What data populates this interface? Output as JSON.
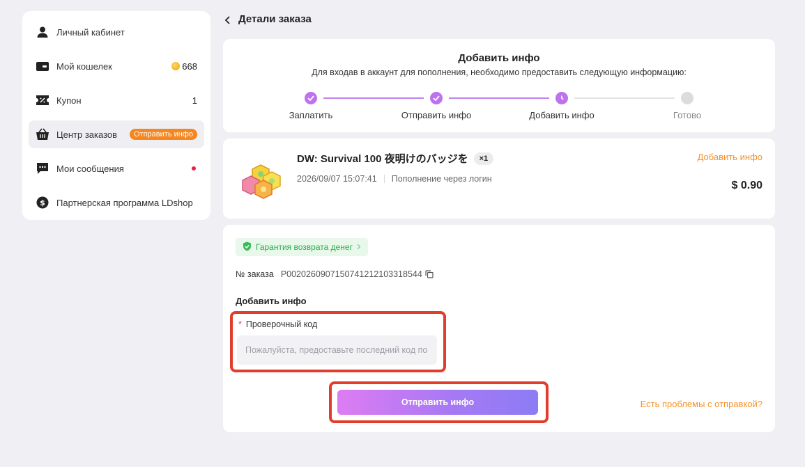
{
  "sidebar": {
    "items": [
      {
        "label": "Личный кабинет",
        "icon": "user-icon"
      },
      {
        "label": "Мой кошелек",
        "icon": "wallet-icon",
        "right": "668"
      },
      {
        "label": "Купон",
        "icon": "coupon-icon",
        "right": "1"
      },
      {
        "label": "Центр заказов",
        "icon": "basket-icon",
        "badge": "Отправить инфо",
        "active": true
      },
      {
        "label": "Мои сообщения",
        "icon": "message-icon",
        "dot": true
      },
      {
        "label": "Партнерская программа LDshop",
        "icon": "dollar-icon"
      }
    ]
  },
  "header": {
    "title": "Детали заказа"
  },
  "steps": {
    "title": "Добавить инфо",
    "subtitle": "Для входав в аккаунт для пополнения, необходимо предоставить следующую информацию:",
    "items": [
      {
        "label": "Заплатить",
        "state": "done"
      },
      {
        "label": "Отправить инфо",
        "state": "done"
      },
      {
        "label": "Добавить инфо",
        "state": "current"
      },
      {
        "label": "Готово",
        "state": "todo"
      }
    ]
  },
  "product": {
    "title": "DW: Survival 100 夜明けのバッジを",
    "qty": "×1",
    "date": "2026/09/07 15:07:41",
    "method": "Пополнение через логин",
    "status": "Добавить инфо",
    "price": "$ 0.90"
  },
  "form": {
    "guarantee": "Гарантия возврата денег",
    "order_label": "№ заказа",
    "order_number": "P0020260907150741212103318544",
    "section_title": "Добавить инфо",
    "field_label": "Проверочный код",
    "field_required": "*",
    "field_placeholder": "Пожалуйста, предоставьте последний код по",
    "submit_label": "Отправить инфо",
    "problem_link": "Есть проблемы с отправкой?"
  },
  "colors": {
    "accent": "#bd73ee",
    "orange": "#f5922b",
    "green": "#2eaa4b",
    "highlight": "#e23d2c"
  }
}
